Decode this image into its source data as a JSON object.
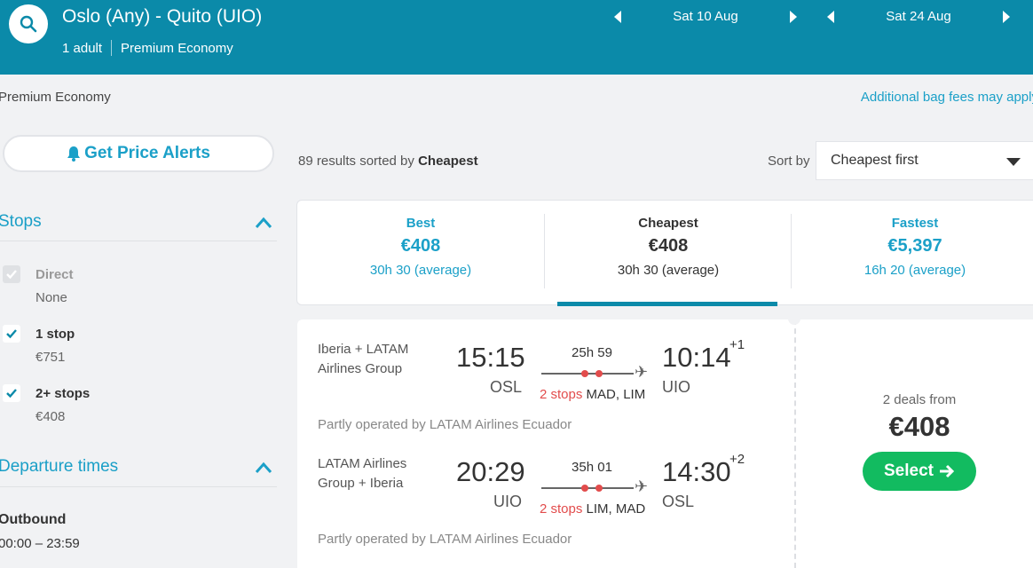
{
  "header": {
    "route": "Oslo (Any) - Quito (UIO)",
    "passengers": "1 adult",
    "cabin": "Premium Economy",
    "outbound_date": "Sat 10 Aug",
    "return_date": "Sat 24 Aug"
  },
  "subheader": {
    "cabin": "Premium Economy",
    "bag_fees": "Additional bag fees may apply"
  },
  "sidebar": {
    "price_alerts": "Get Price Alerts",
    "stops": {
      "title": "Stops",
      "options": [
        {
          "label": "Direct",
          "value": "None",
          "checked": true,
          "disabled": true
        },
        {
          "label": "1 stop",
          "value": "€751",
          "checked": true,
          "disabled": false
        },
        {
          "label": "2+ stops",
          "value": "€408",
          "checked": true,
          "disabled": false
        }
      ]
    },
    "departure": {
      "title": "Departure times",
      "outbound_label": "Outbound",
      "outbound_range": "00:00 – 23:59"
    }
  },
  "results": {
    "count_text": "89 results sorted by",
    "sorted_by": "Cheapest",
    "sort_label": "Sort by",
    "sort_value": "Cheapest first"
  },
  "tabs": [
    {
      "name": "Best",
      "price": "€408",
      "duration": "30h 30 (average)"
    },
    {
      "name": "Cheapest",
      "price": "€408",
      "duration": "30h 30 (average)"
    },
    {
      "name": "Fastest",
      "price": "€5,397",
      "duration": "16h 20 (average)"
    }
  ],
  "card": {
    "legs": [
      {
        "airline": "Iberia + LATAM Airlines Group",
        "dep_time": "15:15",
        "dep_code": "OSL",
        "duration": "25h 59",
        "stops": "2 stops",
        "stop_codes": "MAD, LIM",
        "arr_time": "10:14",
        "arr_offset": "+1",
        "arr_code": "UIO",
        "operated": "Partly operated by LATAM Airlines Ecuador"
      },
      {
        "airline": "LATAM Airlines Group + Iberia",
        "dep_time": "20:29",
        "dep_code": "UIO",
        "duration": "35h 01",
        "stops": "2 stops",
        "stop_codes": "LIM, MAD",
        "arr_time": "14:30",
        "arr_offset": "+2",
        "arr_code": "OSL",
        "operated": "Partly operated by LATAM Airlines Ecuador"
      }
    ],
    "deals": "2 deals from",
    "price": "€408",
    "select": "Select"
  },
  "colors": {
    "header": "#0b8aa9",
    "accent": "#1ba0c8",
    "stops_red": "#e24c4c",
    "select_green": "#12bb60"
  },
  "icons": [
    "search-icon",
    "bell-icon",
    "chevron-up-icon",
    "caret-left-icon",
    "caret-right-icon",
    "check-icon",
    "plane-icon",
    "arrow-right-icon",
    "dropdown-caret-icon"
  ]
}
